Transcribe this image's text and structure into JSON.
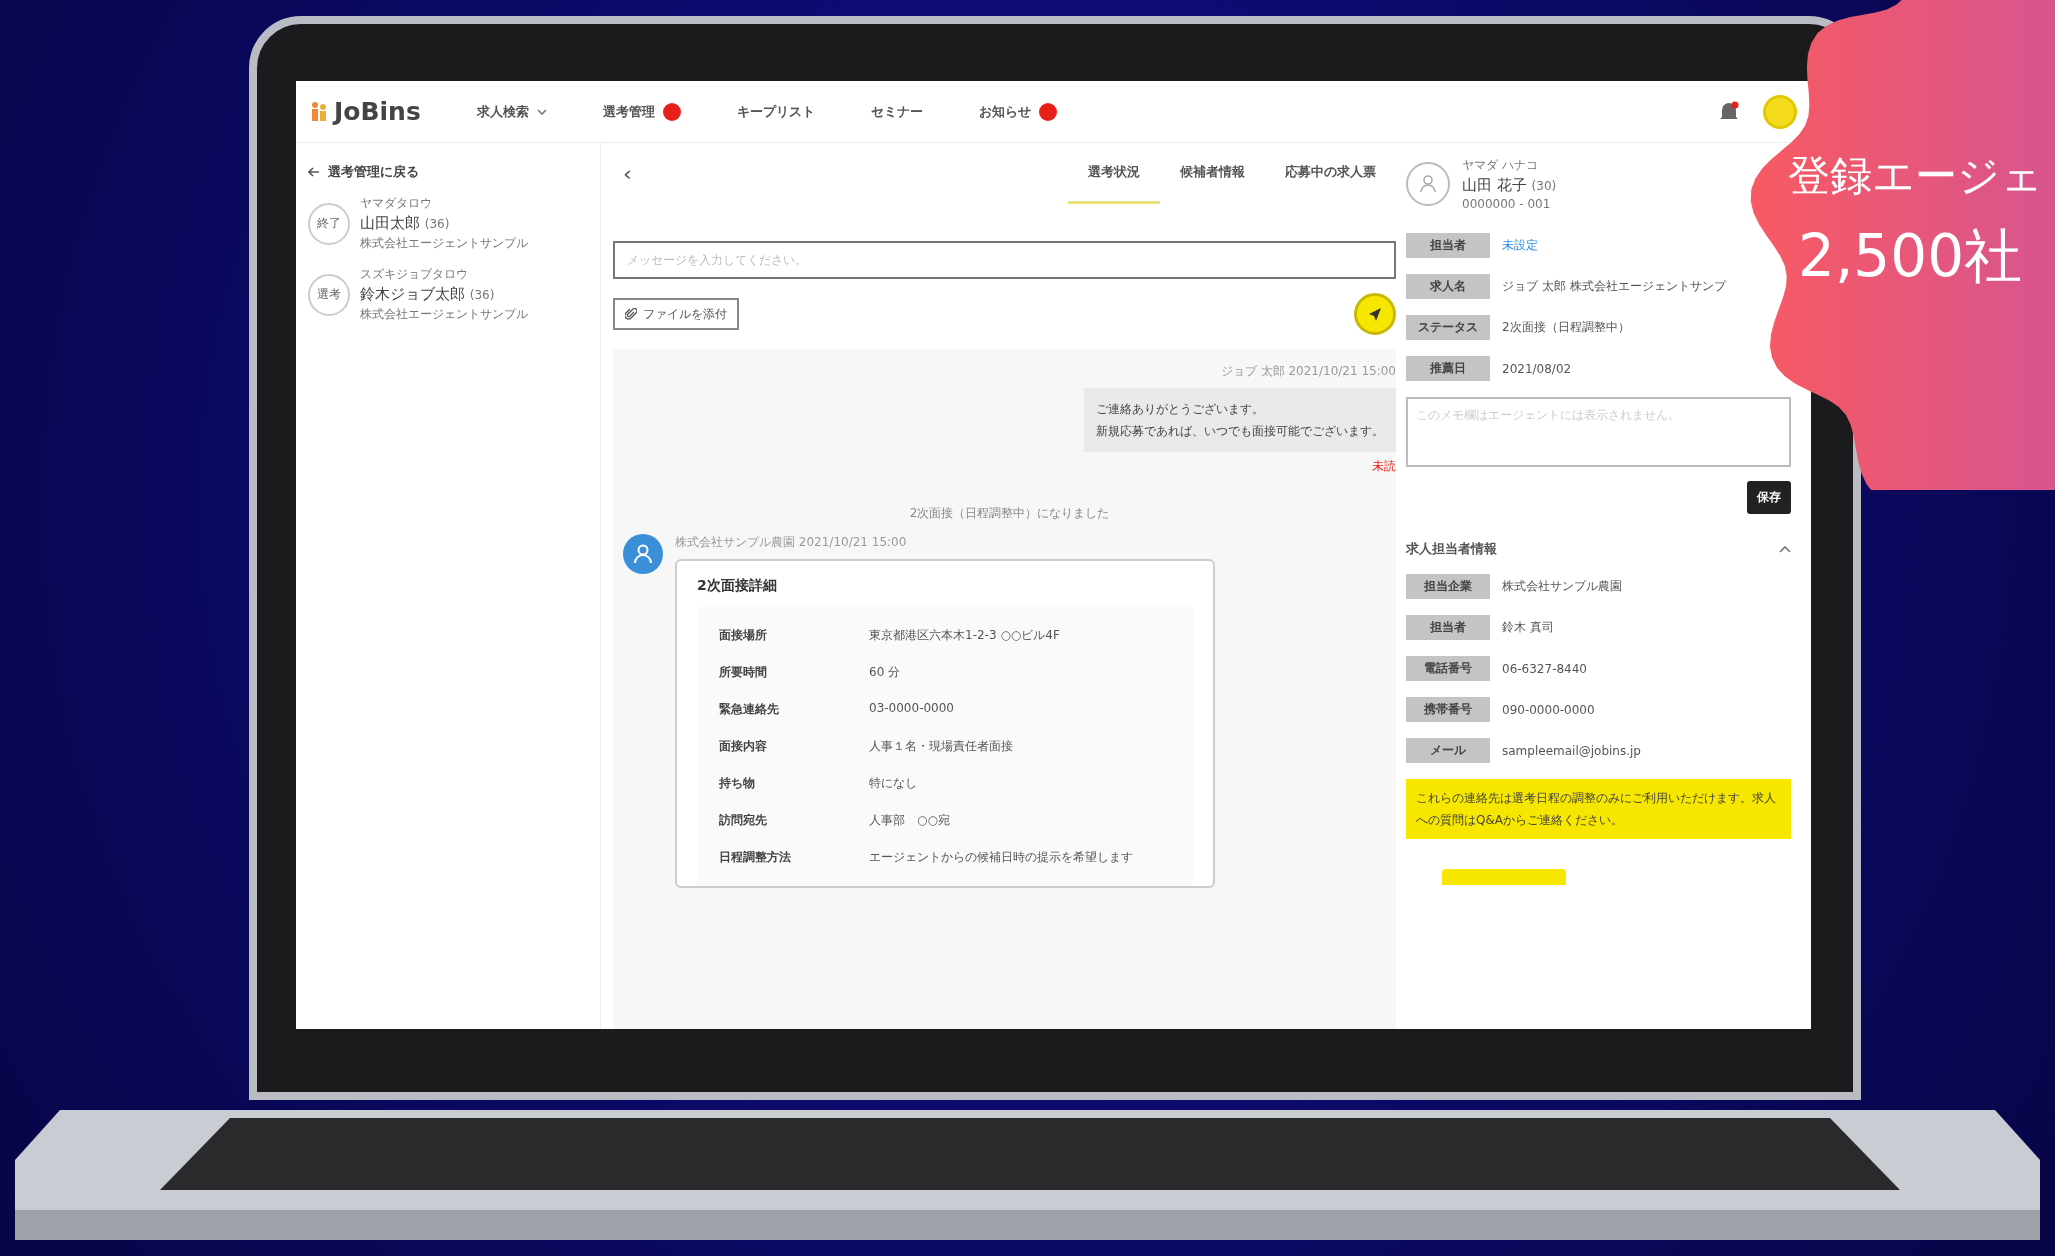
{
  "header": {
    "logo": "JoBins",
    "nav": [
      {
        "label": "求人検索",
        "dropdown": true,
        "badge": false
      },
      {
        "label": "選考管理",
        "dropdown": false,
        "badge": true
      },
      {
        "label": "キープリスト",
        "dropdown": false,
        "badge": false
      },
      {
        "label": "セミナー",
        "dropdown": false,
        "badge": false
      },
      {
        "label": "お知らせ",
        "dropdown": false,
        "badge": true
      }
    ]
  },
  "sidebar": {
    "back_link": "選考管理に戻る",
    "candidates": [
      {
        "status": "終了",
        "kana": "ヤマダタロウ",
        "name": "山田太郎",
        "age": "(36)",
        "company": "株式会社エージェントサンプル"
      },
      {
        "status": "選考",
        "kana": "スズキジョブタロウ",
        "name": "鈴木ジョブ太郎",
        "age": "(36)",
        "company": "株式会社エージェントサンプル"
      }
    ]
  },
  "main": {
    "back": "‹",
    "tabs": [
      {
        "label": "選考状況",
        "selected": true
      },
      {
        "label": "候補者情報",
        "selected": false
      },
      {
        "label": "応募中の求人票",
        "selected": false
      }
    ],
    "message_field": {
      "placeholder": "メッセージを入力してください。"
    },
    "attach_button": "ファイルを添付",
    "messages": [
      {
        "kind": "sent",
        "meta": "ジョブ 太郎 2021/10/21 15:00",
        "lines": [
          "ご連絡ありがとうございます。",
          "新規応募であれば、いつでも面接可能でございます。"
        ],
        "status": "未読"
      },
      {
        "kind": "system",
        "text": "2次面接（日程調整中）になりました"
      },
      {
        "kind": "card",
        "meta": "株式会社サンプル農園 2021/10/21 15:00",
        "title": "2次面接詳細",
        "rows": [
          {
            "label": "面接場所",
            "value": "東京都港区六本木1-2-3 ○○ビル4F"
          },
          {
            "label": "所要時間",
            "value": "60 分"
          },
          {
            "label": "緊急連絡先",
            "value": "03-0000-0000"
          },
          {
            "label": "面接内容",
            "value": "人事１名・現場責任者面接"
          },
          {
            "label": "持ち物",
            "value": "特になし"
          },
          {
            "label": "訪問宛先",
            "value": "人事部　○○宛"
          },
          {
            "label": "日程調整方法",
            "value": "エージェントからの候補日時の提示を希望します"
          }
        ]
      }
    ]
  },
  "candidate_panel": {
    "kana": "ヤマダ ハナコ",
    "name": "山田 花子",
    "age": "(30)",
    "id": "0000000 - 001",
    "fields": [
      {
        "label": "担当者",
        "value": "未設定",
        "kind": "link"
      },
      {
        "label": "求人名",
        "value": "ジョブ 太郎 株式会社エージェントサンプ",
        "kind": "text"
      },
      {
        "label": "ステータス",
        "value": "2次面接（日程調整中）",
        "kind": "text"
      },
      {
        "label": "推薦日",
        "value": "2021/08/02",
        "kind": "text"
      }
    ],
    "memo": {
      "placeholder": "このメモ欄はエージェントには表示されません。"
    },
    "save_button": "保存"
  },
  "contact_panel": {
    "title": "求人担当者情報",
    "expanded": true,
    "fields": [
      {
        "label": "担当企業",
        "value": "株式会社サンプル農園"
      },
      {
        "label": "担当者",
        "value": "鈴木 真司"
      },
      {
        "label": "電話番号",
        "value": "06-6327-8440"
      },
      {
        "label": "携帯番号",
        "value": "090-0000-0000"
      },
      {
        "label": "メール",
        "value": "sampleemail@jobins.jp"
      }
    ],
    "notice": "これらの連絡先は選考日程の調整のみにご利用いただけます。求人への質問はQ&Aからご連絡ください。"
  },
  "promo_badge": {
    "line1": "登録エージェ",
    "line2": "2,500社"
  }
}
